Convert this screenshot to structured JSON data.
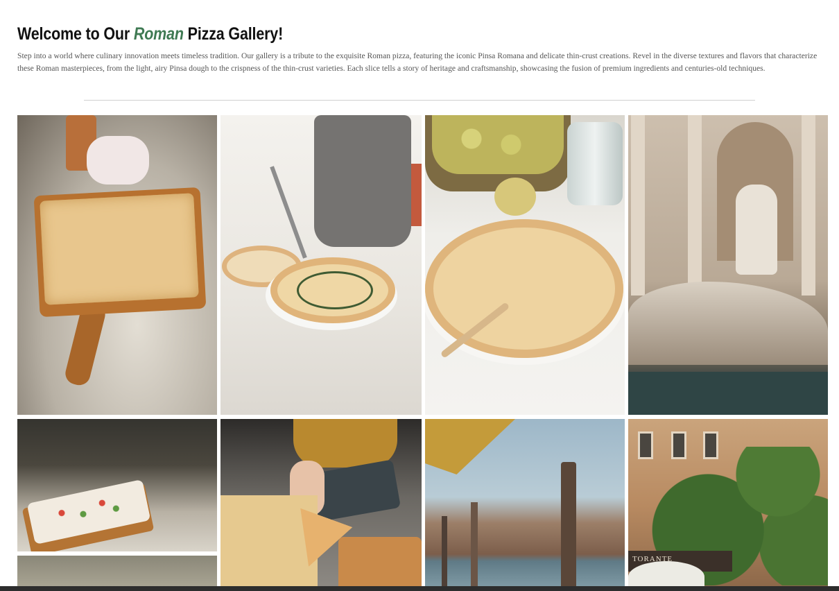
{
  "header": {
    "title_prefix": "Welcome to Our ",
    "title_accent": "Roman",
    "title_suffix": " Pizza Gallery!",
    "intro": "Step into a world where culinary innovation meets timeless tradition. Our gallery is a tribute to the exquisite Roman pizza, featuring the iconic Pinsa Romana and delicate thin-crust creations. Revel in the diverse textures and flavors that characterize these Roman masterpieces, from the light, airy Pinsa dough to the crispness of the thin-crust varieties. Each slice tells a story of heritage and craftsmanship, showcasing the fusion of premium ingredients and centuries-old techniques."
  },
  "colors": {
    "accent": "#3f7a53",
    "text": "#555555",
    "divider": "#cfcfcf"
  },
  "gallery": {
    "items": [
      {
        "subject": "pinsa-on-wooden-board"
      },
      {
        "subject": "chef-serving-pizza"
      },
      {
        "subject": "pizza-with-honey-dipper"
      },
      {
        "subject": "trevi-fountain"
      },
      {
        "subject": "pinsa-on-bar-counter"
      },
      {
        "subject": "partial-image"
      },
      {
        "subject": "hands-over-pizza-slices"
      },
      {
        "subject": "venice-canal"
      },
      {
        "subject": "ivy-covered-restaurant"
      }
    ],
    "sign_text": "TORANTE"
  }
}
